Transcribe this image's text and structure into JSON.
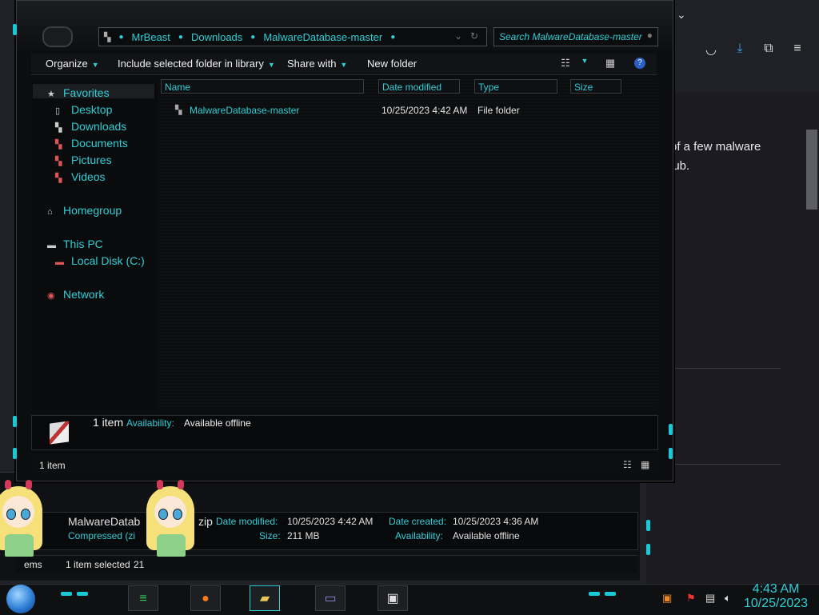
{
  "window": {
    "breadcrumb": [
      "MrBeast",
      "Downloads",
      "MalwareDatabase-master"
    ],
    "search_placeholder": "Search MalwareDatabase-master"
  },
  "toolbar": {
    "organize": "Organize",
    "include": "Include selected folder in library",
    "share": "Share with",
    "new_folder": "New folder",
    "help": "?"
  },
  "nav": {
    "favorites": "Favorites",
    "desktop": "Desktop",
    "downloads": "Downloads",
    "documents": "Documents",
    "pictures": "Pictures",
    "videos": "Videos",
    "homegroup": "Homegroup",
    "this_pc": "This PC",
    "local_disk": "Local Disk (C:)",
    "network": "Network"
  },
  "columns": {
    "name": "Name",
    "date": "Date modified",
    "type": "Type",
    "size": "Size"
  },
  "files": [
    {
      "name": "MalwareDatabase-master",
      "date": "10/25/2023 4:42 AM",
      "type": "File folder"
    }
  ],
  "details": {
    "count": "1 item",
    "availability_label": "Availability:",
    "availability": "Available offline"
  },
  "status": {
    "count": "1 item"
  },
  "window2": {
    "name": "MalwareDatab",
    "ext": "zip",
    "kind": "Compressed (zi",
    "date_modified_label": "Date modified:",
    "date_modified": "10/25/2023 4:42 AM",
    "date_created_label": "Date created:",
    "date_created": "10/25/2023 4:36 AM",
    "size_label": "Size:",
    "size": "211 MB",
    "availability_label": "Availability:",
    "availability": "Available offline",
    "status_items": "ems",
    "status_selected": "1 item selected",
    "status_num": "21"
  },
  "browser": {
    "line1": "of a few malware",
    "line2": "lub."
  },
  "clock": {
    "time": "4:43 AM",
    "date": "10/25/2023"
  },
  "colors": {
    "accent": "#2ecfd6",
    "bg": "#0c0d0f"
  }
}
